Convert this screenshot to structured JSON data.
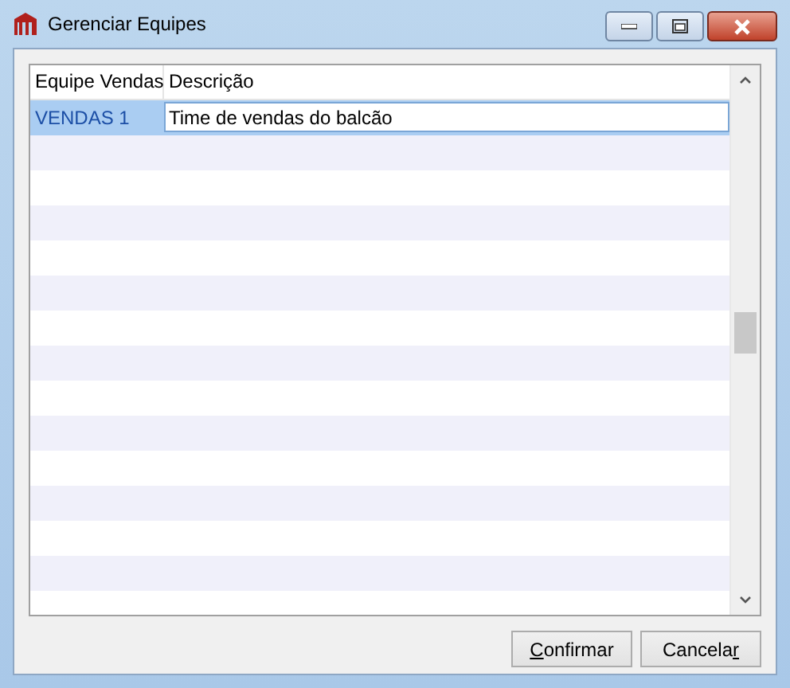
{
  "window": {
    "title": "Gerenciar Equipes"
  },
  "table": {
    "columns": [
      "Equipe Vendas",
      "Descrição"
    ],
    "rows": [
      {
        "cells": [
          "VENDAS 1",
          "Time de vendas do balcão"
        ],
        "selected": true,
        "editing": true
      }
    ]
  },
  "buttons": [
    {
      "access_key": "C",
      "label_rest": "onfirmar"
    },
    {
      "label_start": "Cancela",
      "access_key": "r"
    }
  ]
}
